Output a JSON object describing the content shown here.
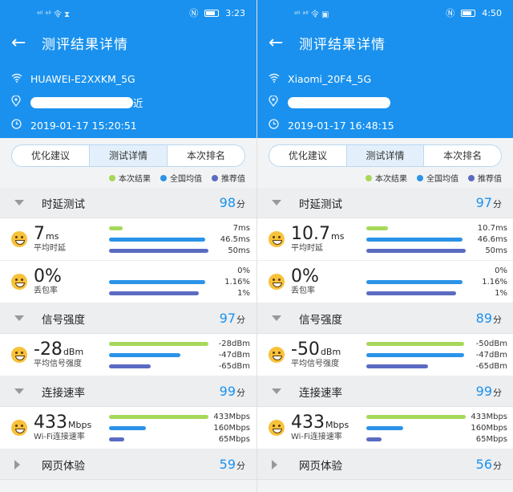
{
  "panels": [
    {
      "status": {
        "left_text": "ᵃˡˡ ᵃˡˡ 令 ⧗",
        "time": "3:23"
      },
      "title": "测评结果详情",
      "ssid": "HUAWEI-E2XXKM_5G",
      "location_tail": "近",
      "datetime": "2019-01-17 15:20:51",
      "tabs": [
        "优化建议",
        "测试详情",
        "本次排名"
      ],
      "active_tab": 1,
      "legend": [
        {
          "label": "本次结果",
          "color": "#a6d85a"
        },
        {
          "label": "全国均值",
          "color": "#2b93e8"
        },
        {
          "label": "推荐值",
          "color": "#5b6bc2"
        }
      ],
      "sections": [
        {
          "name": "时延测试",
          "score": "98",
          "score_unit": "分",
          "expanded": true,
          "metrics": [
            {
              "value": "7",
              "unit": "ms",
              "label": "平均时延",
              "bars": [
                {
                  "text": "7ms",
                  "fraction": 0.14
                },
                {
                  "text": "46.5ms",
                  "fraction": 0.97
                },
                {
                  "text": "50ms",
                  "fraction": 1.0
                }
              ]
            },
            {
              "value": "0%",
              "unit": "",
              "label": "丢包率",
              "bars": [
                {
                  "text": "0%",
                  "fraction": 0.0
                },
                {
                  "text": "1.16%",
                  "fraction": 0.97
                },
                {
                  "text": "1%",
                  "fraction": 0.9
                }
              ]
            }
          ]
        },
        {
          "name": "信号强度",
          "score": "97",
          "score_unit": "分",
          "expanded": true,
          "metrics": [
            {
              "value": "-28",
              "unit": "dBm",
              "label": "平均信号强度",
              "bars": [
                {
                  "text": "-28dBm",
                  "fraction": 1.0
                },
                {
                  "text": "-47dBm",
                  "fraction": 0.72
                },
                {
                  "text": "-65dBm",
                  "fraction": 0.42
                }
              ]
            }
          ]
        },
        {
          "name": "连接速率",
          "score": "99",
          "score_unit": "分",
          "expanded": true,
          "metrics": [
            {
              "value": "433",
              "unit": "Mbps",
              "label": "Wi-Fi连接速率",
              "bars": [
                {
                  "text": "433Mbps",
                  "fraction": 1.0
                },
                {
                  "text": "160Mbps",
                  "fraction": 0.37
                },
                {
                  "text": "65Mbps",
                  "fraction": 0.15
                }
              ]
            }
          ]
        },
        {
          "name": "网页体验",
          "score": "59",
          "score_unit": "分",
          "expanded": false,
          "metrics": []
        }
      ]
    },
    {
      "status": {
        "left_text": "ᵃˡˡ ᵃˡˡ 令 ▣",
        "time": "4:50"
      },
      "title": "测评结果详情",
      "ssid": "Xiaomi_20F4_5G",
      "location_tail": "",
      "datetime": "2019-01-17 16:48:15",
      "tabs": [
        "优化建议",
        "测试详情",
        "本次排名"
      ],
      "active_tab": 1,
      "legend": [
        {
          "label": "本次结果",
          "color": "#a6d85a"
        },
        {
          "label": "全国均值",
          "color": "#2b93e8"
        },
        {
          "label": "推荐值",
          "color": "#5b6bc2"
        }
      ],
      "sections": [
        {
          "name": "时延测试",
          "score": "97",
          "score_unit": "分",
          "expanded": true,
          "metrics": [
            {
              "value": "10.7",
              "unit": "ms",
              "label": "平均时延",
              "bars": [
                {
                  "text": "10.7ms",
                  "fraction": 0.22
                },
                {
                  "text": "46.6ms",
                  "fraction": 0.97
                },
                {
                  "text": "50ms",
                  "fraction": 1.0
                }
              ]
            },
            {
              "value": "0%",
              "unit": "",
              "label": "丢包率",
              "bars": [
                {
                  "text": "0%",
                  "fraction": 0.0
                },
                {
                  "text": "1.16%",
                  "fraction": 0.97
                },
                {
                  "text": "1%",
                  "fraction": 0.9
                }
              ]
            }
          ]
        },
        {
          "name": "信号强度",
          "score": "89",
          "score_unit": "分",
          "expanded": true,
          "metrics": [
            {
              "value": "-50",
              "unit": "dBm",
              "label": "平均信号强度",
              "bars": [
                {
                  "text": "-50dBm",
                  "fraction": 0.98
                },
                {
                  "text": "-47dBm",
                  "fraction": 0.98
                },
                {
                  "text": "-65dBm",
                  "fraction": 0.62
                }
              ]
            }
          ]
        },
        {
          "name": "连接速率",
          "score": "99",
          "score_unit": "分",
          "expanded": true,
          "metrics": [
            {
              "value": "433",
              "unit": "Mbps",
              "label": "Wi-Fi连接速率",
              "bars": [
                {
                  "text": "433Mbps",
                  "fraction": 1.0
                },
                {
                  "text": "160Mbps",
                  "fraction": 0.37
                },
                {
                  "text": "65Mbps",
                  "fraction": 0.15
                }
              ]
            }
          ]
        },
        {
          "name": "网页体验",
          "score": "56",
          "score_unit": "分",
          "expanded": false,
          "metrics": []
        }
      ]
    }
  ],
  "icons": {
    "back": "back-arrow-icon",
    "wifi": "wifi-icon",
    "location": "location-pin-icon",
    "clock": "clock-icon",
    "emoji": "smiley-face-icon",
    "nfc": "nfc-icon",
    "battery": "battery-icon"
  }
}
